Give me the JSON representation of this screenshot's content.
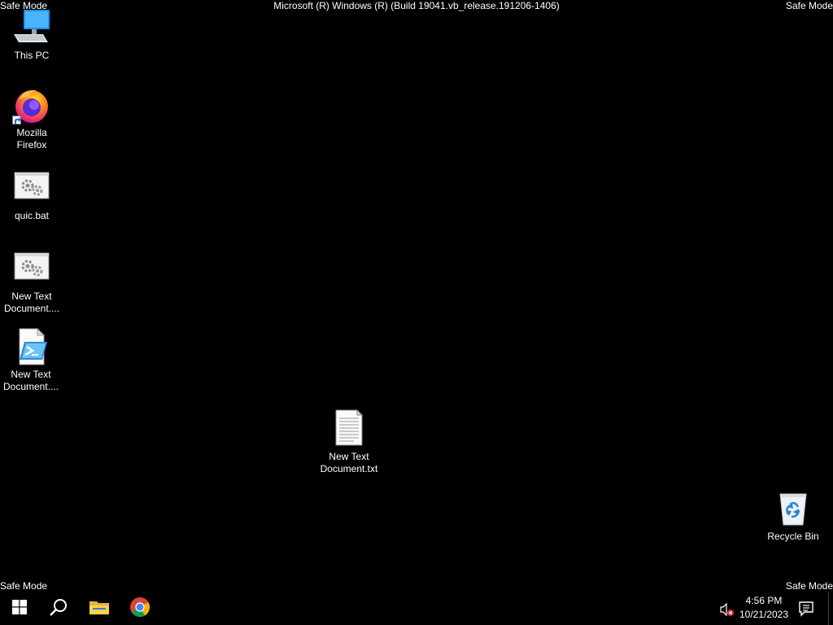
{
  "watermark": {
    "top_left": "Safe Mode",
    "top_right": "Safe Mode",
    "bottom_left": "Safe Mode",
    "bottom_right": "Safe Mode",
    "title": "Microsoft (R) Windows (R) (Build 19041.vb_release.191206-1406)"
  },
  "desktop": {
    "icons": [
      {
        "label": "This PC",
        "icon": "computer-icon"
      },
      {
        "label": "Mozilla Firefox",
        "icon": "firefox-icon"
      },
      {
        "label": "quic.bat",
        "icon": "batch-file-icon"
      },
      {
        "label": "New Text Document....",
        "icon": "batch-file-icon"
      },
      {
        "label": "New Text Document....",
        "icon": "powershell-script-icon"
      },
      {
        "label": "New Text Document.txt",
        "icon": "text-document-icon"
      },
      {
        "label": "Recycle Bin",
        "icon": "recycle-bin-icon"
      }
    ]
  },
  "taskbar": {
    "buttons": [
      {
        "name": "start-button",
        "icon": "windows-logo-icon"
      },
      {
        "name": "search-button",
        "icon": "search-icon"
      },
      {
        "name": "file-explorer-button",
        "icon": "folder-icon"
      },
      {
        "name": "chrome-button",
        "icon": "chrome-icon"
      }
    ],
    "clock": {
      "time": "4:56 PM",
      "date": "10/21/2023"
    },
    "tray": {
      "volume_icon": "volume-muted-icon",
      "notification_icon": "action-center-icon"
    }
  },
  "colors": {
    "background": "#000000",
    "text": "#ffffff",
    "accent": "#0078d7"
  }
}
